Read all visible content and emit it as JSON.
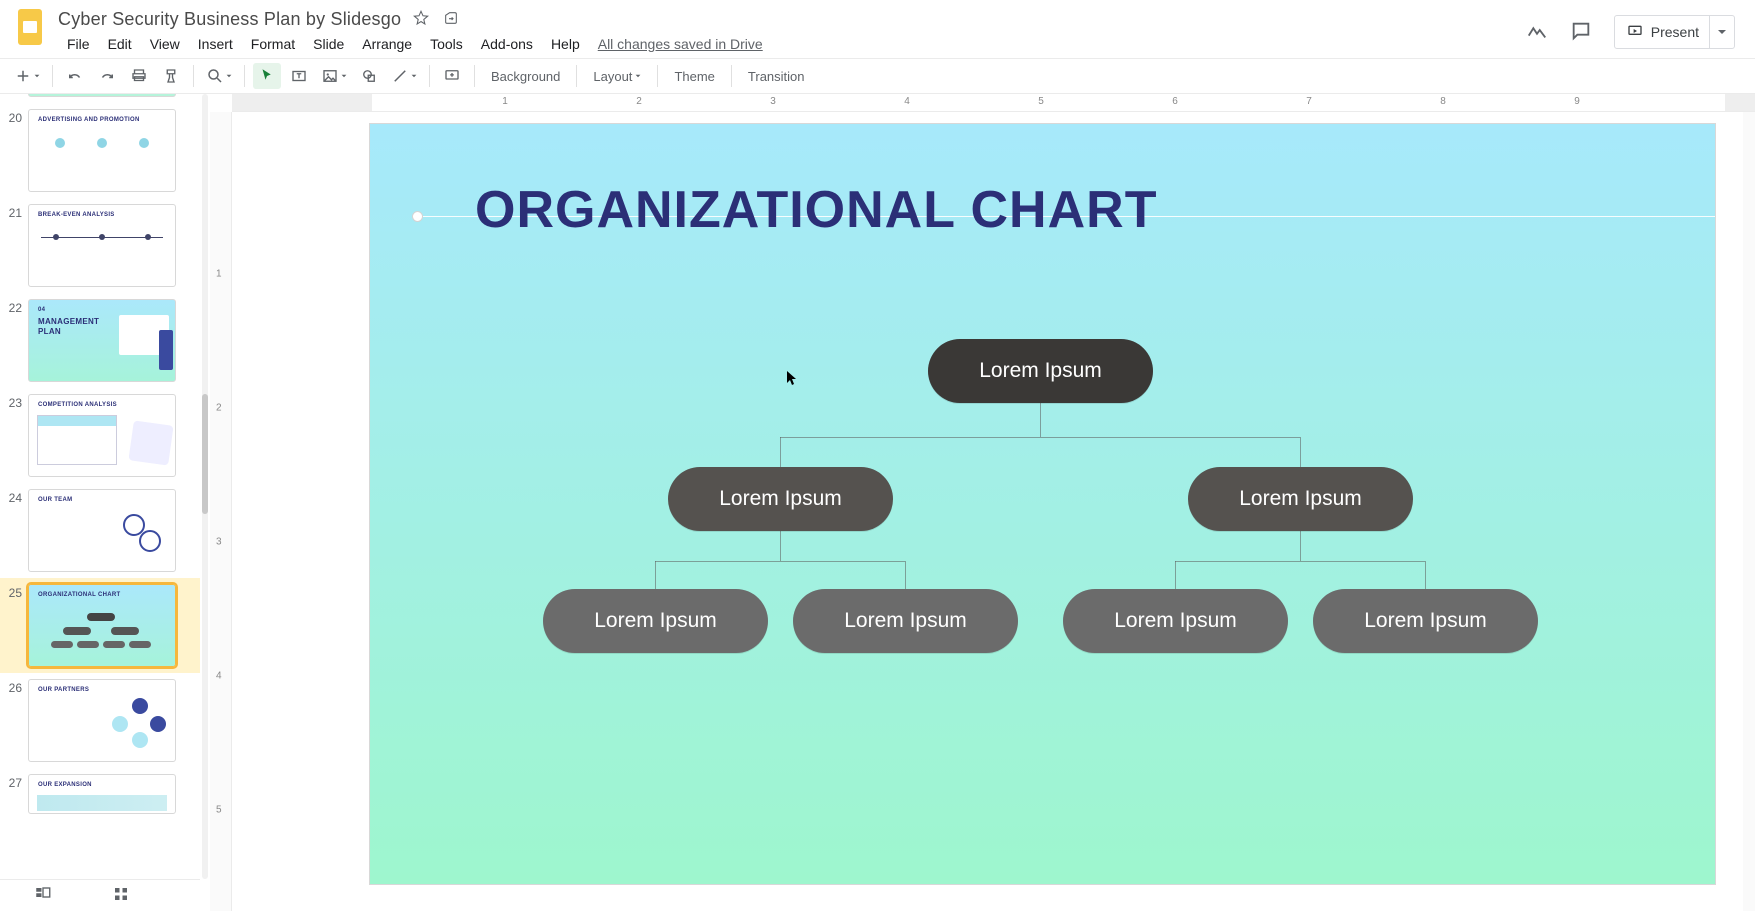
{
  "doc": {
    "title": "Cyber Security Business Plan by Slidesgo"
  },
  "menu": {
    "file": "File",
    "edit": "Edit",
    "view": "View",
    "insert": "Insert",
    "format": "Format",
    "slide": "Slide",
    "arrange": "Arrange",
    "tools": "Tools",
    "addons": "Add-ons",
    "help": "Help",
    "save_status": "All changes saved in Drive"
  },
  "header_buttons": {
    "present": "Present"
  },
  "toolbar": {
    "background": "Background",
    "layout": "Layout",
    "theme": "Theme",
    "transition": "Transition"
  },
  "ruler": {
    "h": [
      "1",
      "2",
      "3",
      "4",
      "5",
      "6",
      "7",
      "8",
      "9"
    ],
    "v": [
      "1",
      "2",
      "3",
      "4",
      "5"
    ]
  },
  "filmstrip": {
    "slides": [
      {
        "num": "20",
        "type": "white",
        "label": "ADVERTISING AND PROMOTION"
      },
      {
        "num": "21",
        "type": "white",
        "label": "BREAK-EVEN ANALYSIS"
      },
      {
        "num": "22",
        "type": "grad",
        "label": "04",
        "label2": "MANAGEMENT",
        "label3": "PLAN"
      },
      {
        "num": "23",
        "type": "white",
        "label": "COMPETITION ANALYSIS"
      },
      {
        "num": "24",
        "type": "white",
        "label": "OUR TEAM"
      },
      {
        "num": "25",
        "type": "grad",
        "label": "ORGANIZATIONAL CHART",
        "current": true
      },
      {
        "num": "26",
        "type": "white",
        "label": "OUR PARTNERS"
      },
      {
        "num": "27",
        "type": "white",
        "label": "OUR EXPANSION"
      }
    ]
  },
  "slide": {
    "title": "ORGANIZATIONAL CHART",
    "nodes": {
      "root": "Lorem Ipsum",
      "l1a": "Lorem Ipsum",
      "l1b": "Lorem Ipsum",
      "l2a": "Lorem Ipsum",
      "l2b": "Lorem Ipsum",
      "l2c": "Lorem Ipsum",
      "l2d": "Lorem Ipsum"
    }
  }
}
